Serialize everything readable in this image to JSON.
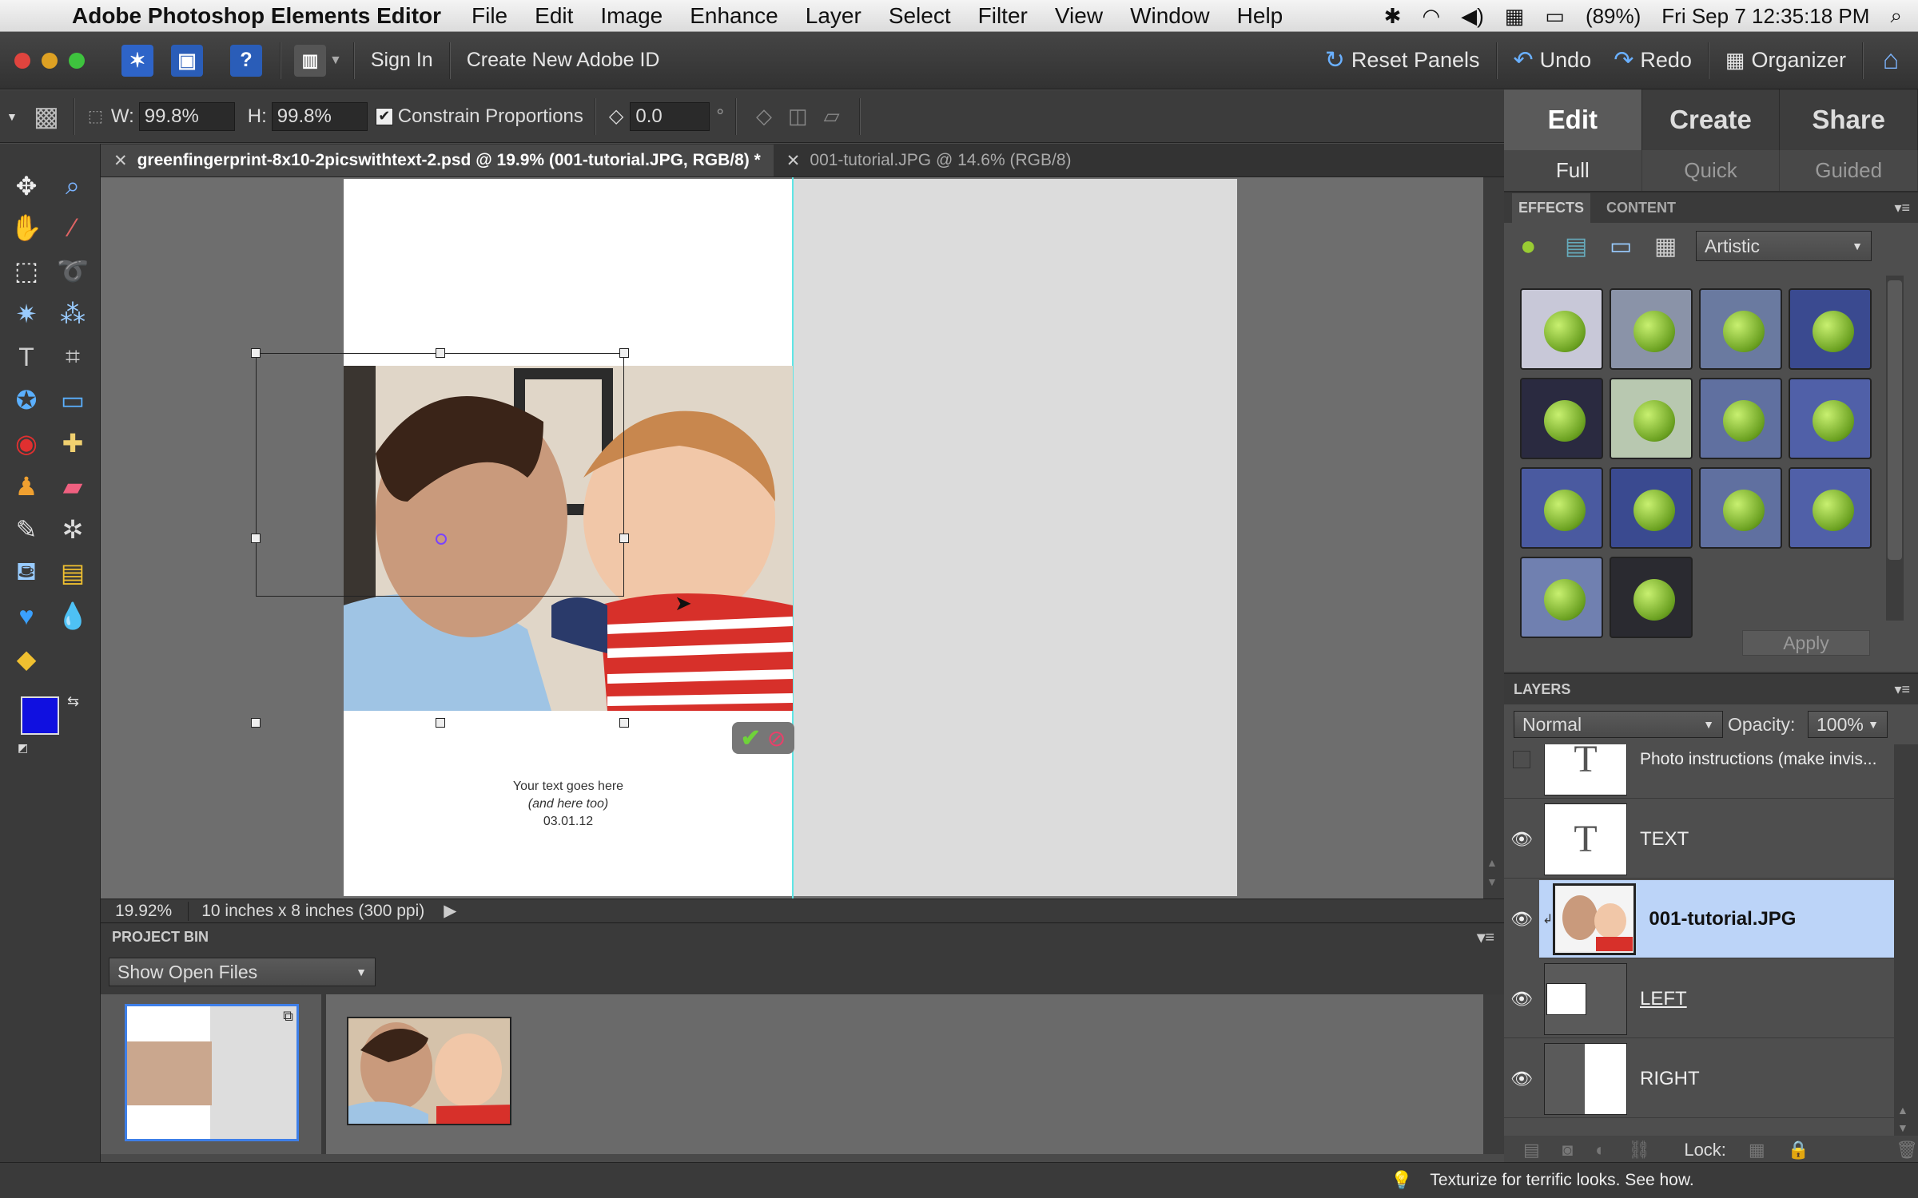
{
  "menubar": {
    "app_name": "Adobe Photoshop Elements Editor",
    "items": [
      "File",
      "Edit",
      "Image",
      "Enhance",
      "Layer",
      "Select",
      "Filter",
      "View",
      "Window",
      "Help"
    ],
    "battery": "(89%)",
    "datetime": "Fri Sep 7  12:35:18 PM"
  },
  "appbar": {
    "sign_in": "Sign In",
    "create_id": "Create New Adobe ID",
    "reset_panels": "Reset Panels",
    "undo": "Undo",
    "redo": "Redo",
    "organizer": "Organizer",
    "help_glyph": "?"
  },
  "options": {
    "w_label": "W:",
    "w_value": "99.8%",
    "h_label": "H:",
    "h_value": "99.8%",
    "constrain": "Constrain Proportions",
    "angle_value": "0.0",
    "degree_symbol": "°"
  },
  "tabs": {
    "doc1": "greenfingerprint-8x10-2picswithtext-2.psd @ 19.9% (001-tutorial.JPG, RGB/8) *",
    "doc2": "001-tutorial.JPG @ 14.6% (RGB/8)",
    "close_glyph": "✕"
  },
  "canvas": {
    "text_line1": "Your text goes here",
    "text_line2": "(and here too)",
    "text_line3": "03.01.12"
  },
  "status": {
    "zoom": "19.92%",
    "doc_info": "10 inches x 8 inches (300 ppi)"
  },
  "project_bin": {
    "title": "PROJECT BIN",
    "filter": "Show Open Files"
  },
  "right_panel": {
    "tabs": [
      "Edit",
      "Create",
      "Share"
    ],
    "modes": [
      "Full",
      "Quick",
      "Guided"
    ],
    "effects_tab": "EFFECTS",
    "content_tab": "CONTENT",
    "category": "Artistic",
    "apply": "Apply"
  },
  "layers": {
    "title": "LAYERS",
    "blend_mode": "Normal",
    "opacity_label": "Opacity:",
    "opacity_value": "100%",
    "lock_label": "Lock:",
    "items": [
      {
        "name": "Photo instructions (make invis..."
      },
      {
        "name": "TEXT"
      },
      {
        "name": "001-tutorial.JPG"
      },
      {
        "name": "LEFT"
      },
      {
        "name": "RIGHT"
      }
    ]
  },
  "tip": "Texturize for terrific looks. See how.",
  "colors": {
    "foreground": "#1010e0",
    "background": "#ffffff",
    "selected_layer": "#bcd4f8"
  }
}
